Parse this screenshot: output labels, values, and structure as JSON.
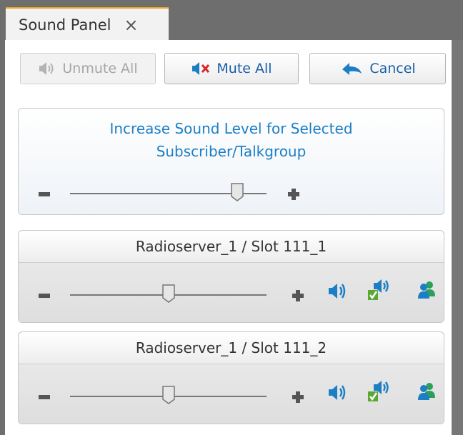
{
  "tab": {
    "title": "Sound Panel",
    "close": "×"
  },
  "toolbar": {
    "unmute_all_label": "Unmute All",
    "mute_all_label": "Mute All",
    "cancel_label": "Cancel"
  },
  "selected": {
    "title_line1": "Increase Sound Level for Selected",
    "title_line2": "Subscriber/Talkgroup",
    "level": 0.85
  },
  "channels": [
    {
      "name": "Radioserver_1 / Slot 111_1",
      "level": 0.5
    },
    {
      "name": "Radioserver_1 / Slot 111_2",
      "level": 0.5
    }
  ],
  "colors": {
    "accent": "#1c7fc6",
    "tab_border": "#e8a320",
    "mute_red": "#d9262b",
    "group_green": "#2e9e5b"
  },
  "icons": [
    "close-icon",
    "speaker-icon",
    "mute-icon",
    "cancel-arrow-icon",
    "speaker-icon",
    "speaker-check-icon",
    "group-icon"
  ]
}
